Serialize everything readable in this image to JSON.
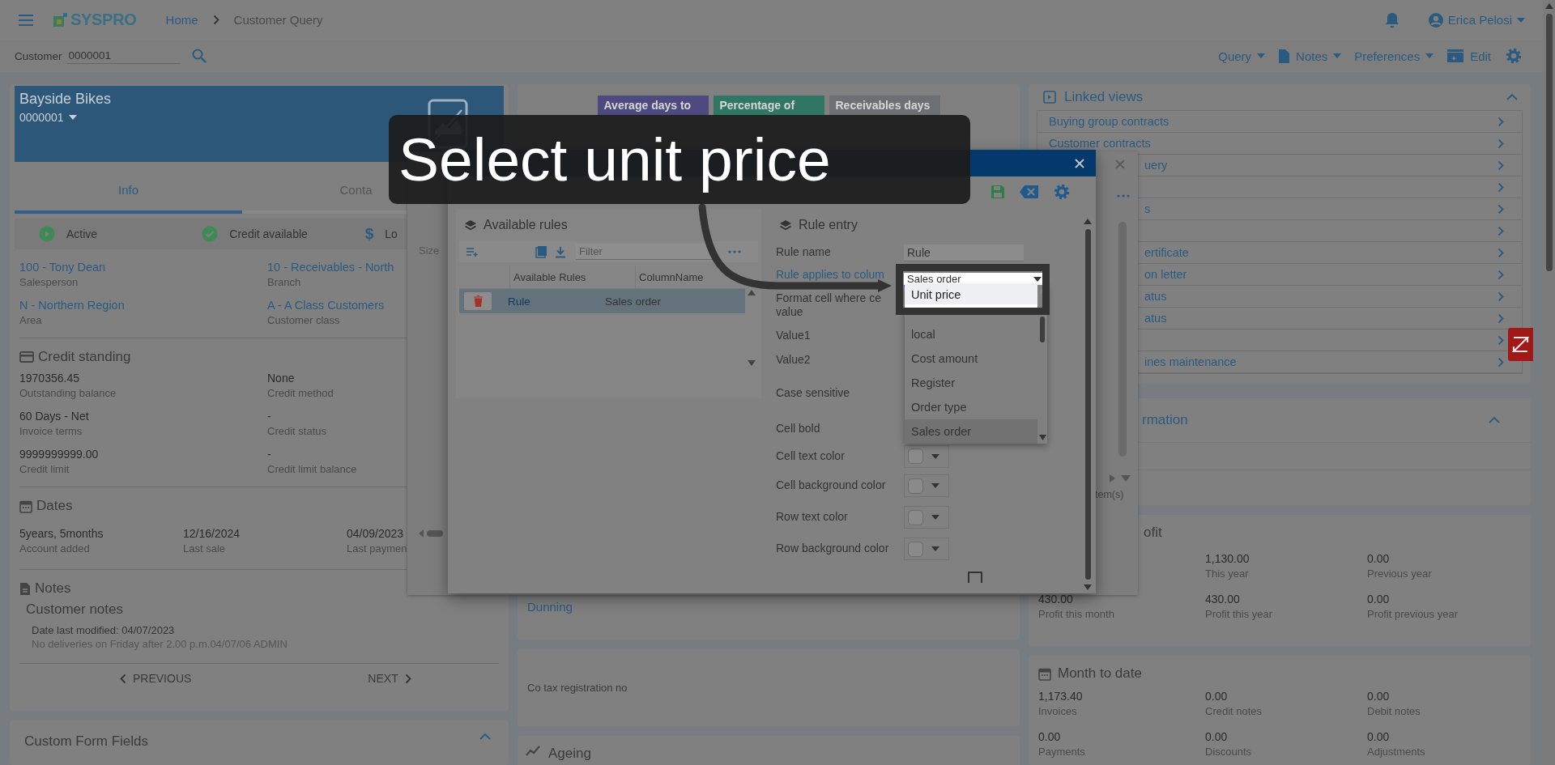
{
  "header": {
    "app_name": "SYSPRO",
    "breadcrumb": [
      "Home",
      "Customer Query"
    ],
    "user": "Erica Pelosi"
  },
  "toolbar": {
    "customer_label": "Customer",
    "customer_value": "0000001",
    "menus": [
      {
        "label": "Query",
        "kind": "menu"
      },
      {
        "label": "Notes",
        "kind": "notes"
      },
      {
        "label": "Preferences",
        "kind": "menu"
      },
      {
        "label": "Edit",
        "kind": "edit"
      }
    ]
  },
  "customer_card": {
    "name": "Bayside Bikes",
    "code": "0000001",
    "tabs": [
      {
        "label": "Info",
        "selected": true
      },
      {
        "label": "Conta",
        "selected": false
      }
    ],
    "statuses": [
      {
        "label": "Active",
        "kind": "play"
      },
      {
        "label": "Credit available",
        "kind": "check"
      },
      {
        "label": "Lo",
        "kind": "dollar",
        "icon": "$"
      }
    ],
    "fields": [
      {
        "value": "100 - Tony Dean",
        "label": "Salesperson"
      },
      {
        "value": "10 - Receivables - North",
        "label": "Branch"
      },
      {
        "value": "N - Northern Region",
        "label": "Area"
      },
      {
        "value": "A - A Class Customers",
        "label": "Customer class"
      }
    ],
    "credit_standing": {
      "title": "Credit standing",
      "fields": [
        {
          "value": "1970356.45",
          "label": "Outstanding balance"
        },
        {
          "value": "None",
          "label": "Credit method"
        },
        {
          "value": "60 Days - Net",
          "label": "Invoice terms"
        },
        {
          "value": "-",
          "label": "Credit status"
        },
        {
          "value": "9999999999.00",
          "label": "Credit limit"
        },
        {
          "value": "-",
          "label": "Credit limit balance"
        }
      ]
    },
    "dates": {
      "title": "Dates",
      "fields": [
        {
          "value": "5years, 5months",
          "label": "Account added"
        },
        {
          "value": "12/16/2024",
          "label": "Last sale"
        },
        {
          "value": "04/09/2023",
          "label": "Last paymen"
        }
      ]
    },
    "notes": {
      "title": "Notes",
      "subtitle": "Customer notes",
      "modified": "Date last modified: 04/07/2023",
      "text": "No deliveries on Friday after 2.00 p.m.04/07/06 ADMIN"
    },
    "previous": "PREVIOUS",
    "next": "NEXT"
  },
  "custom_form_fields": {
    "title": "Custom Form Fields"
  },
  "kpi_tiles": [
    {
      "title": "Average days to",
      "color": "#4c4a7e"
    },
    {
      "title": "Percentage of",
      "color": "#2f7665"
    },
    {
      "title": "Receivables days",
      "color": "#6c7074"
    }
  ],
  "middle": {
    "dunning": "Dunning",
    "tax_label": "Co tax registration no",
    "ageing": "Ageing"
  },
  "linked_views": {
    "title": "Linked views",
    "items": [
      {
        "kind": "link",
        "label": "Buying group contracts"
      },
      {
        "kind": "link",
        "label": "Customer contracts"
      },
      {
        "kind": "link",
        "label": "uery"
      },
      {
        "kind": "covered"
      },
      {
        "kind": "link",
        "label": "s"
      },
      {
        "kind": "covered"
      },
      {
        "kind": "link",
        "label": "ertificate"
      },
      {
        "kind": "link",
        "label": "on letter"
      },
      {
        "kind": "link",
        "label": "atus"
      },
      {
        "kind": "link",
        "label": "atus"
      },
      {
        "kind": "covered"
      },
      {
        "kind": "link",
        "label": "ines maintenance"
      }
    ]
  },
  "information": {
    "title": "rmation"
  },
  "profit": {
    "title": "ofit",
    "fields": [
      {
        "value": "1,130.00",
        "label": "This year"
      },
      {
        "value": "0.00",
        "label": "Previous year"
      },
      {
        "value": "430.00",
        "label": "Profit this month"
      },
      {
        "value": "430.00",
        "label": "Profit this year"
      },
      {
        "value": "0.00",
        "label": "Profit previous year"
      }
    ]
  },
  "month_to_date": {
    "title": "Month to date",
    "fields": [
      {
        "value": "1,173.40",
        "label": "Invoices"
      },
      {
        "value": "0.00",
        "label": "Credit notes"
      },
      {
        "value": "0.00",
        "label": "Debit notes"
      },
      {
        "value": "0.00",
        "label": "Payments"
      },
      {
        "value": "0.00",
        "label": "Discounts"
      },
      {
        "value": "0.00",
        "label": "Adjustments"
      }
    ]
  },
  "back_dialog": {
    "column_header": "Size",
    "footer": "tem(s)"
  },
  "dialog": {
    "available_rules": {
      "title": "Available rules",
      "filter_placeholder": "Filter",
      "columns": [
        "Available Rules",
        "ColumnName"
      ],
      "rows": [
        {
          "rule": "Rule",
          "column": "Sales order",
          "selected": true
        }
      ]
    },
    "rule_entry": {
      "title": "Rule entry",
      "rows": [
        {
          "label": "Rule name",
          "kind": "text",
          "value": "Rule"
        },
        {
          "label": "Rule applies to colum",
          "kind": "select",
          "value": "Sales order"
        },
        {
          "label": "Format cell where ce\nvalue",
          "kind": "none"
        },
        {
          "label": "Value1",
          "kind": "none"
        },
        {
          "label": "Value2",
          "kind": "none"
        },
        {
          "label": "Case sensitive",
          "kind": "none"
        },
        {
          "label": "Cell bold",
          "kind": "none"
        },
        {
          "label": "Cell text color",
          "kind": "color"
        },
        {
          "label": "Cell background color",
          "kind": "color"
        },
        {
          "label": "Row text color",
          "kind": "color"
        },
        {
          "label": "Row background color",
          "kind": "color"
        }
      ],
      "checkbox": {
        "checked": false
      }
    },
    "dropdown": [
      {
        "label": "Unit price",
        "selected": false,
        "hovered": true
      },
      {
        "label": "local",
        "selected": false,
        "hovered": false
      },
      {
        "label": "Cost amount",
        "selected": false,
        "hovered": false
      },
      {
        "label": "Register",
        "selected": false,
        "hovered": false
      },
      {
        "label": "Order type",
        "selected": false,
        "hovered": false
      },
      {
        "label": "Sales order",
        "selected": true,
        "hovered": false
      }
    ]
  },
  "callout": {
    "text": "Select unit price"
  }
}
